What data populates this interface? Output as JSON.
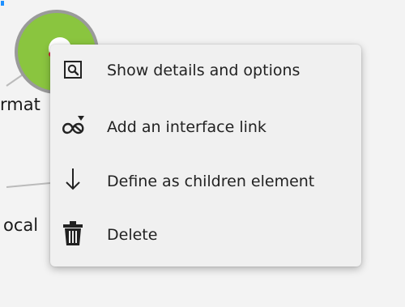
{
  "graph": {
    "node_labels": [
      "rmat",
      "ocal"
    ],
    "node_color": "#8ac53f",
    "node_border_color": "#9a9a9a",
    "marker_color": "#d7263d"
  },
  "context_menu": {
    "items": [
      {
        "label": "Show details and options",
        "icon": "magnifier-icon"
      },
      {
        "label": "Add an interface link",
        "icon": "interface-link-icon"
      },
      {
        "label": "Define as children element",
        "icon": "arrow-down-icon"
      },
      {
        "label": "Delete",
        "icon": "trash-icon"
      }
    ]
  },
  "colors": {
    "menu_background": "#f0f0f0",
    "text": "#222222",
    "canvas_background": "#f3f3f3"
  }
}
